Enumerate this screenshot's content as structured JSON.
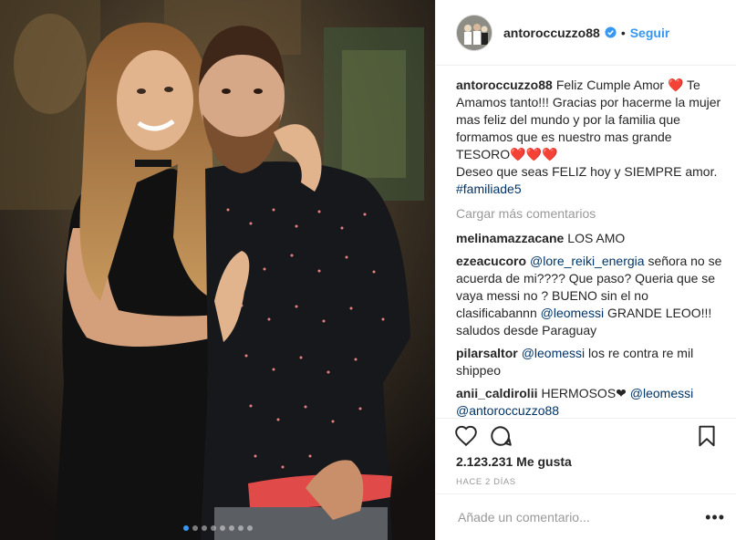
{
  "post": {
    "username": "antoroccuzzo88",
    "follow_label": "Seguir",
    "separator": "•",
    "caption": {
      "username": "antoroccuzzo88",
      "text": "Feliz Cumple Amor ❤️ Te Amamos tanto!!! Gracias por hacerme la mujer mas feliz del mundo y por la familia que formamos que es nuestro mas grande TESORO❤️❤️❤️\nDeseo que seas FELIZ hoy y SIEMPRE amor.",
      "hashtag": "#familiade5"
    },
    "load_more": "Cargar más comentarios",
    "comments": [
      {
        "username": "melinamazzacane",
        "text": "LOS AMO",
        "mention": "",
        "after": ""
      },
      {
        "username": "ezeacucoro",
        "mention": "@lore_reiki_energia",
        "after": " señora no se acuerda de mi???? Que paso? Queria que se vaya messi no ? BUENO sin el no clasificabannn ",
        "mention2": "@leomessi",
        "after2": " GRANDE LEOO!!! saludos desde Paraguay"
      },
      {
        "username": "pilarsaltor",
        "mention": "@leomessi",
        "after": " los re contra re mil shippeo"
      },
      {
        "username": "anii_caldirolii",
        "text": "HERMOSOS❤",
        "mention": "@leomessi",
        "mention2": "@antoroccuzzo88"
      }
    ],
    "likes": "2.123.231 Me gusta",
    "time": "HACE 2 DÍAS",
    "comment_placeholder": "Añade un comentario...",
    "more_label": "•••",
    "carousel": {
      "count": 8,
      "active": 0
    },
    "colors": {
      "accent": "#3897f0",
      "text": "#262626",
      "muted": "#999999",
      "mention": "#003569"
    },
    "icons": [
      "heart-icon",
      "comment-icon",
      "bookmark-icon",
      "verified-badge-icon"
    ]
  }
}
